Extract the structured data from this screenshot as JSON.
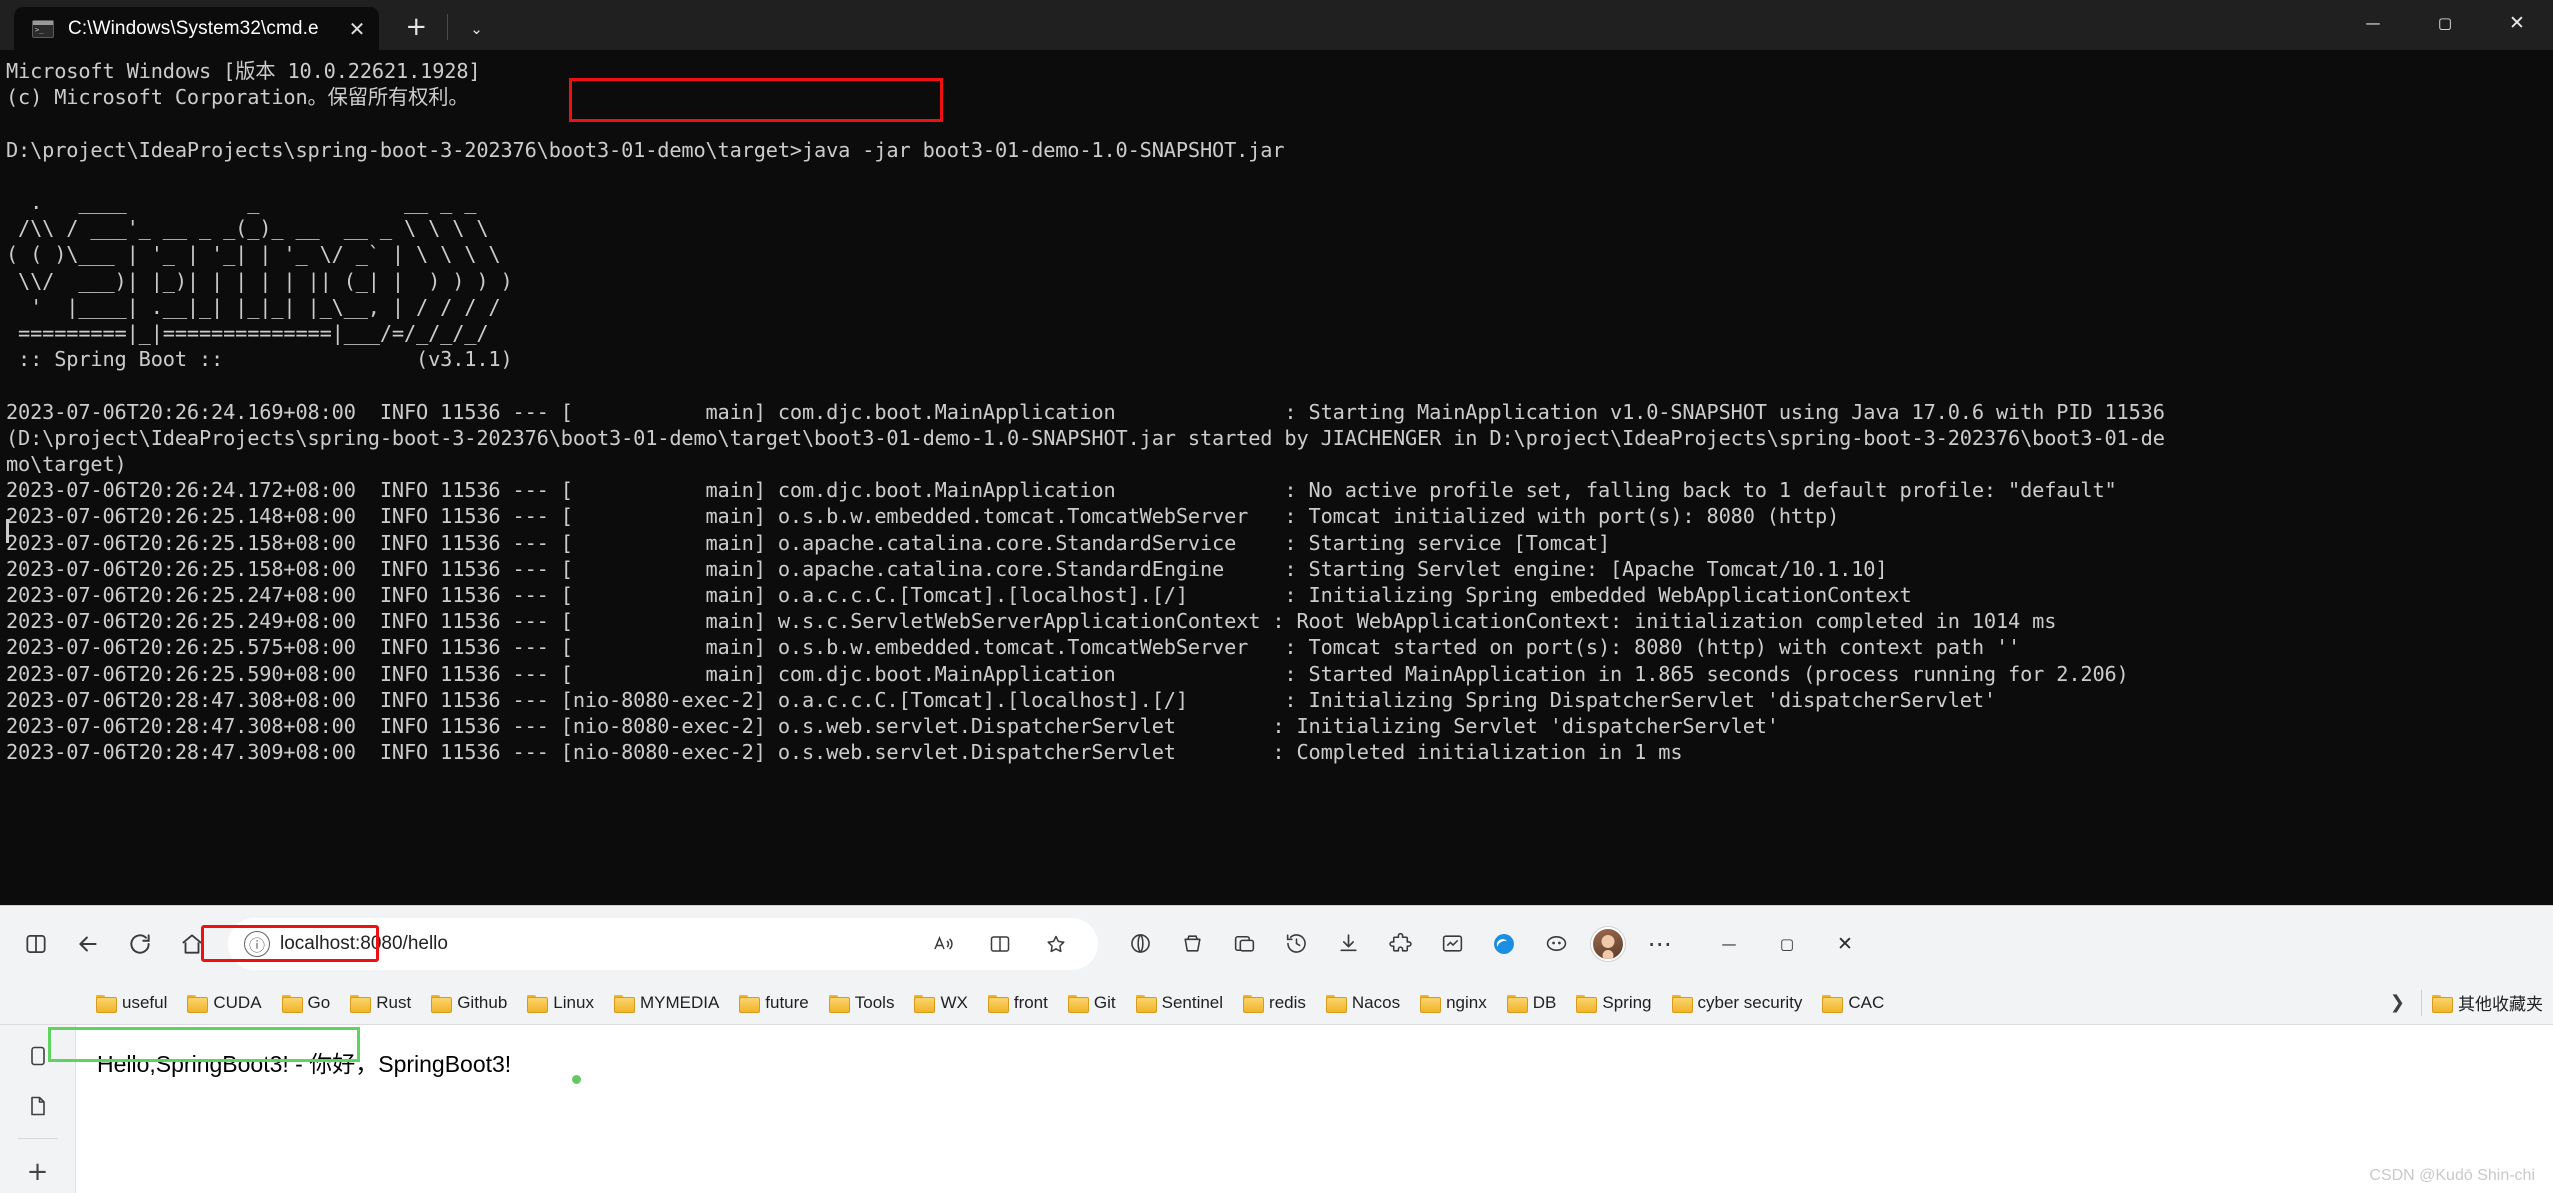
{
  "terminal": {
    "tab": {
      "title": "C:\\Windows\\System32\\cmd.e",
      "close_label": "✕",
      "icon": "cmd-icon"
    },
    "new_tab_label": "+",
    "dropdown_label": "⌄",
    "window_controls": {
      "minimize": "—",
      "maximize": "▢",
      "close": "✕"
    },
    "lines": [
      "Microsoft Windows [版本 10.0.22621.1928]",
      "(c) Microsoft Corporation。保留所有权利。",
      "",
      "D:\\project\\IdeaProjects\\spring-boot-3-202376\\boot3-01-demo\\target>java -jar boot3-01-demo-1.0-SNAPSHOT.jar",
      "",
      "  .   ____          _            __ _ _",
      " /\\\\ / ___'_ __ _ _(_)_ __  __ _ \\ \\ \\ \\",
      "( ( )\\___ | '_ | '_| | '_ \\/ _` | \\ \\ \\ \\",
      " \\\\/  ___)| |_)| | | | | || (_| |  ) ) ) )",
      "  '  |____| .__|_| |_|_| |_\\__, | / / / /",
      " =========|_|==============|___/=/_/_/_/",
      " :: Spring Boot ::                (v3.1.1)",
      "",
      "2023-07-06T20:26:24.169+08:00  INFO 11536 --- [           main] com.djc.boot.MainApplication              : Starting MainApplication v1.0-SNAPSHOT using Java 17.0.6 with PID 11536",
      "(D:\\project\\IdeaProjects\\spring-boot-3-202376\\boot3-01-demo\\target\\boot3-01-demo-1.0-SNAPSHOT.jar started by JIACHENGER in D:\\project\\IdeaProjects\\spring-boot-3-202376\\boot3-01-de",
      "mo\\target)",
      "2023-07-06T20:26:24.172+08:00  INFO 11536 --- [           main] com.djc.boot.MainApplication              : No active profile set, falling back to 1 default profile: \"default\"",
      "2023-07-06T20:26:25.148+08:00  INFO 11536 --- [           main] o.s.b.w.embedded.tomcat.TomcatWebServer   : Tomcat initialized with port(s): 8080 (http)",
      "2023-07-06T20:26:25.158+08:00  INFO 11536 --- [           main] o.apache.catalina.core.StandardService    : Starting service [Tomcat]",
      "2023-07-06T20:26:25.158+08:00  INFO 11536 --- [           main] o.apache.catalina.core.StandardEngine     : Starting Servlet engine: [Apache Tomcat/10.1.10]",
      "2023-07-06T20:26:25.247+08:00  INFO 11536 --- [           main] o.a.c.c.C.[Tomcat].[localhost].[/]        : Initializing Spring embedded WebApplicationContext",
      "2023-07-06T20:26:25.249+08:00  INFO 11536 --- [           main] w.s.c.ServletWebServerApplicationContext : Root WebApplicationContext: initialization completed in 1014 ms",
      "2023-07-06T20:26:25.575+08:00  INFO 11536 --- [           main] o.s.b.w.embedded.tomcat.TomcatWebServer   : Tomcat started on port(s): 8080 (http) with context path ''",
      "2023-07-06T20:26:25.590+08:00  INFO 11536 --- [           main] com.djc.boot.MainApplication              : Started MainApplication in 1.865 seconds (process running for 2.206)",
      "2023-07-06T20:28:47.308+08:00  INFO 11536 --- [nio-8080-exec-2] o.a.c.c.C.[Tomcat].[localhost].[/]        : Initializing Spring DispatcherServlet 'dispatcherServlet'",
      "2023-07-06T20:28:47.308+08:00  INFO 11536 --- [nio-8080-exec-2] o.s.web.servlet.DispatcherServlet        : Initializing Servlet 'dispatcherServlet'",
      "2023-07-06T20:28:47.309+08:00  INFO 11536 --- [nio-8080-exec-2] o.s.web.servlet.DispatcherServlet        : Completed initialization in 1 ms"
    ],
    "highlight_color": "#ee1111"
  },
  "browser": {
    "nav": {
      "split_screen_icon": "app-split-icon",
      "back_label": "←",
      "reload_label": "⟳",
      "home_label": "⌂"
    },
    "omnibox": {
      "info_label": "ⓘ",
      "url": "localhost:8080/hello",
      "read_aloud_label": "Aᐣ",
      "split_label": "▯▯",
      "favorite_label": "☆"
    },
    "actions": {
      "browser_essentials": "◎",
      "collections": "⛋",
      "split_screen": "⧉",
      "history": "🕘",
      "downloads": "⭳",
      "extensions": "🧩",
      "performance": "▣",
      "edge_logo": "e",
      "settings_more": "◉",
      "profile": "avatar",
      "more_label": "⋯"
    },
    "window_controls": {
      "minimize": "—",
      "maximize": "▢",
      "close": "✕"
    },
    "bookmarks": [
      "useful",
      "CUDA",
      "Go",
      "Rust",
      "Github",
      "Linux",
      "MYMEDIA",
      "future",
      "Tools",
      "WX",
      "front",
      "Git",
      "Sentinel",
      "redis",
      "Nacos",
      "nginx",
      "DB",
      "Spring",
      "cyber security",
      "CAC"
    ],
    "bookmarks_overflow_label": "❯",
    "other_favorites_label": "其他收藏夹",
    "page": {
      "body_text": "Hello,SpringBoot3! - 你好，SpringBoot3!",
      "highlight_color": "#5fd35f"
    },
    "watermark": "CSDN @Kudō Shin-chi",
    "url_highlight_color": "#ee1111"
  }
}
